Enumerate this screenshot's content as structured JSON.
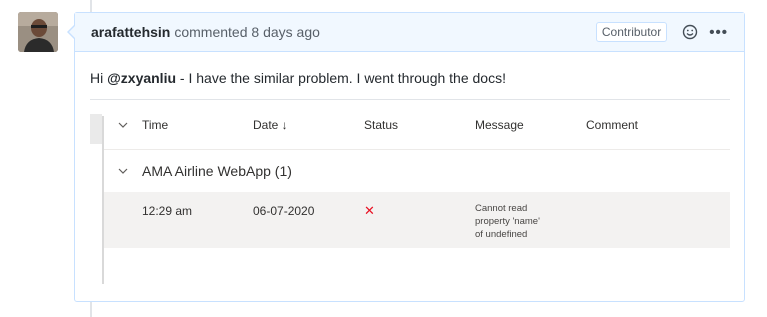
{
  "comment": {
    "author": "arafattehsin",
    "meta": "commented 8 days ago",
    "role_badge": "Contributor",
    "body_prefix": "Hi ",
    "mention": "@zxyanliu",
    "body_suffix": " - I have the similar problem. I went through the docs!"
  },
  "table": {
    "columns": {
      "time": "Time",
      "date": "Date ↓",
      "status": "Status",
      "message": "Message",
      "comment": "Comment"
    },
    "group": {
      "title": "AMA Airline WebApp (1)"
    },
    "rows": [
      {
        "time": "12:29 am",
        "date": "06-07-2020",
        "status": "✕",
        "message_lines": [
          "Cannot read",
          "property 'name'",
          "of undefined"
        ],
        "comment": ""
      }
    ]
  },
  "icons": {
    "emoji": "smiley-icon",
    "more": "kebab-icon",
    "chevron": "chevron-down-icon",
    "status_failed": "x-icon"
  },
  "colors": {
    "header_bg": "#f1f8ff",
    "border": "#c8e1ff",
    "status_failed": "#e81123",
    "row_bg": "#f3f2f1"
  }
}
